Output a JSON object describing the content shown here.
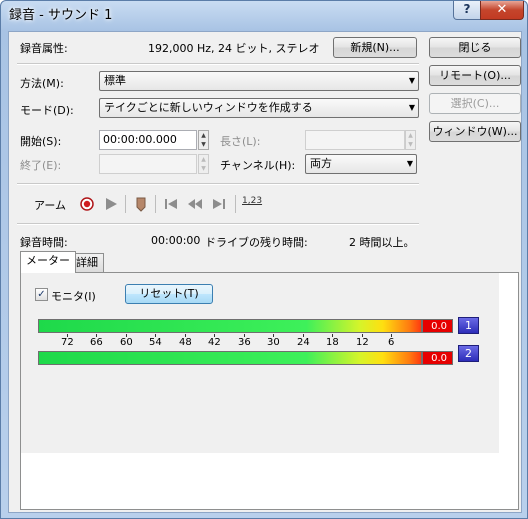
{
  "window": {
    "title": "録音 - サウンド 1",
    "help_label": "?",
    "close_label": "✕"
  },
  "properties": {
    "label": "録音属性:",
    "value": "192,000 Hz, 24 ビット, ステレオ",
    "new_button": "新規(N)..."
  },
  "buttons": {
    "close": "閉じる",
    "remote": "リモート(O)...",
    "select": "選択(C)...",
    "window": "ウィンドウ(W)..."
  },
  "method": {
    "label": "方法(M):",
    "value": "標準"
  },
  "mode": {
    "label": "モード(D):",
    "value": "テイクごとに新しいウィンドウを作成する"
  },
  "start": {
    "label": "開始(S):",
    "value": "00:00:00.000"
  },
  "length": {
    "label": "長さ(L):",
    "value": ""
  },
  "end": {
    "label": "終了(E):",
    "value": ""
  },
  "channel": {
    "label": "チャンネル(H):",
    "value": "両方"
  },
  "toolbar": {
    "arm_label": "アーム",
    "counter_label": "1,23"
  },
  "status": {
    "rec_time_label": "録音時間:",
    "rec_time_value": "00:00:00",
    "drive_label": "ドライブの残り時間:",
    "drive_value": "2 時間以上。"
  },
  "tabs": [
    {
      "label": "メーター"
    },
    {
      "label": "詳細"
    }
  ],
  "meter": {
    "monitor_label": "モニタ(I)",
    "monitor_checked": "✓",
    "reset_label": "リセット(T)",
    "peak_left": "0.0",
    "peak_right": "0.0",
    "channel_1": "1",
    "channel_2": "2",
    "scale": [
      "72",
      "66",
      "60",
      "54",
      "48",
      "42",
      "36",
      "30",
      "24",
      "18",
      "12",
      "6"
    ]
  }
}
